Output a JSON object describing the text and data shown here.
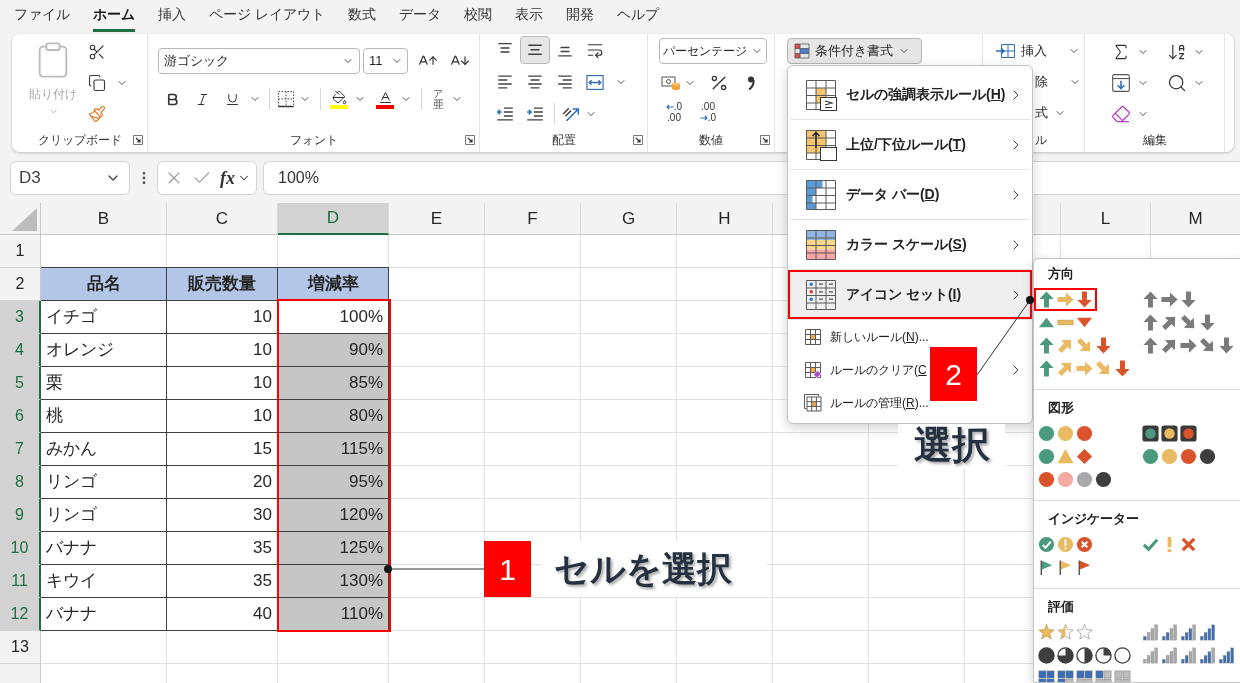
{
  "ribbon_tabs": [
    {
      "label": "ファイル",
      "selected": false
    },
    {
      "label": "ホーム",
      "selected": true
    },
    {
      "label": "挿入",
      "selected": false
    },
    {
      "label": "ページ レイアウト",
      "selected": false
    },
    {
      "label": "数式",
      "selected": false
    },
    {
      "label": "データ",
      "selected": false
    },
    {
      "label": "校閲",
      "selected": false
    },
    {
      "label": "表示",
      "selected": false
    },
    {
      "label": "開発",
      "selected": false
    },
    {
      "label": "ヘルプ",
      "selected": false
    }
  ],
  "ribbon": {
    "clipboard": {
      "paste": "貼り付け",
      "paste_disabled": true,
      "title": "クリップボード"
    },
    "font": {
      "font_name": "游ゴシック",
      "font_size": "11",
      "phonetic": {
        "ruby": "ア",
        "base": "亜"
      },
      "title": "フォント"
    },
    "alignment": {
      "vertical": [
        {
          "kind": "top",
          "selected": false
        },
        {
          "kind": "middle",
          "selected": true
        },
        {
          "kind": "bottom",
          "selected": false
        }
      ],
      "title": "配置"
    },
    "number": {
      "format": "パーセンテージ",
      "decimals": [
        {
          "kind": "increase",
          "top": ".0",
          "bottom": ".00"
        },
        {
          "kind": "decrease",
          "top": ".00",
          "bottom": ".0"
        }
      ],
      "title": "数値"
    },
    "styles": {
      "conditional_formatting": "条件付き書式",
      "pressed": true
    },
    "cells": {
      "insert": "挿入",
      "delete": "除",
      "format": "式",
      "title": "ル"
    },
    "editing": {
      "title": "編集"
    }
  },
  "formula_bar": {
    "name_box": "D3",
    "function_button": "fx",
    "formula": "100%"
  },
  "sheet": {
    "columns": [
      {
        "label": "B",
        "selected": false
      },
      {
        "label": "C",
        "selected": false
      },
      {
        "label": "D",
        "selected": true
      },
      {
        "label": "E",
        "selected": false
      },
      {
        "label": "F",
        "selected": false
      },
      {
        "label": "G",
        "selected": false
      },
      {
        "label": "H",
        "selected": false
      },
      {
        "label": "L",
        "selected": false
      },
      {
        "label": "M",
        "selected": false
      }
    ],
    "rows": [
      {
        "label": "1",
        "selected": false,
        "kind": "blank"
      },
      {
        "label": "2",
        "selected": false,
        "kind": "header",
        "name": "品名",
        "quantity": "販売数量",
        "rate": "増減率"
      },
      {
        "label": "3",
        "selected": true,
        "kind": "data",
        "name": "イチゴ",
        "quantity": "10",
        "rate": "100%",
        "active": true
      },
      {
        "label": "4",
        "selected": true,
        "kind": "data",
        "name": "オレンジ",
        "quantity": "10",
        "rate": "90%",
        "active": false
      },
      {
        "label": "5",
        "selected": true,
        "kind": "data",
        "name": "栗",
        "quantity": "10",
        "rate": "85%",
        "active": false
      },
      {
        "label": "6",
        "selected": true,
        "kind": "data",
        "name": "桃",
        "quantity": "10",
        "rate": "80%",
        "active": false
      },
      {
        "label": "7",
        "selected": true,
        "kind": "data",
        "name": "みかん",
        "quantity": "15",
        "rate": "115%",
        "active": false
      },
      {
        "label": "8",
        "selected": true,
        "kind": "data",
        "name": "リンゴ",
        "quantity": "20",
        "rate": "95%",
        "active": false
      },
      {
        "label": "9",
        "selected": true,
        "kind": "data",
        "name": "リンゴ",
        "quantity": "30",
        "rate": "120%",
        "active": false
      },
      {
        "label": "10",
        "selected": true,
        "kind": "data",
        "name": "バナナ",
        "quantity": "35",
        "rate": "125%",
        "active": false
      },
      {
        "label": "11",
        "selected": true,
        "kind": "data",
        "name": "キウイ",
        "quantity": "35",
        "rate": "130%",
        "active": false
      },
      {
        "label": "12",
        "selected": true,
        "kind": "data",
        "name": "バナナ",
        "quantity": "40",
        "rate": "110%",
        "active": false
      },
      {
        "label": "13",
        "selected": false,
        "kind": "blank"
      }
    ]
  },
  "conditional_menu": {
    "items": [
      {
        "kind": "highlight",
        "before": "セルの強調表示ルール(",
        "key": "H",
        "after": ")",
        "submenu": true,
        "highlighted": false
      },
      {
        "kind": "topbottom",
        "before": "上位/下位ルール(",
        "key": "T",
        "after": ")",
        "submenu": true,
        "highlighted": false
      },
      {
        "kind": "databar",
        "before": "データ バー(",
        "key": "D",
        "after": ")",
        "submenu": true,
        "highlighted": false
      },
      {
        "kind": "colorscale",
        "before": "カラー スケール(",
        "key": "S",
        "after": ")",
        "submenu": true,
        "highlighted": false
      },
      {
        "kind": "iconset",
        "before": "アイコン セット(",
        "key": "I",
        "after": ")",
        "submenu": true,
        "highlighted": true
      },
      {
        "kind": "newrule",
        "before": "新しいルール(",
        "key": "N",
        "after": ")...",
        "submenu": false,
        "highlighted": false
      },
      {
        "kind": "clearrules",
        "before": "ルールのクリア(",
        "key": "C",
        "submenu": true,
        "highlighted": false
      },
      {
        "kind": "managerules",
        "before": "ルールの管理(",
        "key": "R",
        "after": ")...",
        "submenu": false,
        "highlighted": false
      }
    ]
  },
  "icon_set_menu": {
    "sections": [
      {
        "title": "方向",
        "options": [
          {
            "kind": "arrows3color",
            "highlighted": true
          },
          {
            "kind": "arrows3gray",
            "highlighted": false
          },
          {
            "kind": "triangles3",
            "highlighted": false
          },
          {
            "kind": "arrows4gray",
            "highlighted": false
          },
          {
            "kind": "arrows4color",
            "highlighted": false
          },
          {
            "kind": "arrows5gray",
            "highlighted": false
          },
          {
            "kind": "arrows5color",
            "highlighted": false
          }
        ]
      },
      {
        "title": "図形",
        "options": [
          {
            "kind": "circles3",
            "highlighted": false
          },
          {
            "kind": "rimmed3",
            "highlighted": false
          },
          {
            "kind": "signs3",
            "highlighted": false
          },
          {
            "kind": "circles4",
            "highlighted": false
          },
          {
            "kind": "redblack4",
            "highlighted": false
          }
        ]
      },
      {
        "title": "インジケーター",
        "options": [
          {
            "kind": "symbolscircled3",
            "highlighted": false
          },
          {
            "kind": "symbols3",
            "highlighted": false
          },
          {
            "kind": "flags3",
            "highlighted": false
          }
        ]
      },
      {
        "title": "評価",
        "options": [
          {
            "kind": "stars3",
            "highlighted": false
          },
          {
            "kind": "signal4",
            "highlighted": false
          },
          {
            "kind": "quarters5",
            "highlighted": false
          },
          {
            "kind": "signal5",
            "highlighted": false
          },
          {
            "kind": "boxes5",
            "highlighted": false
          }
        ]
      }
    ]
  },
  "annotations": [
    {
      "number": "1",
      "label": "セルを選択"
    },
    {
      "number": "2",
      "label": "選択"
    }
  ]
}
